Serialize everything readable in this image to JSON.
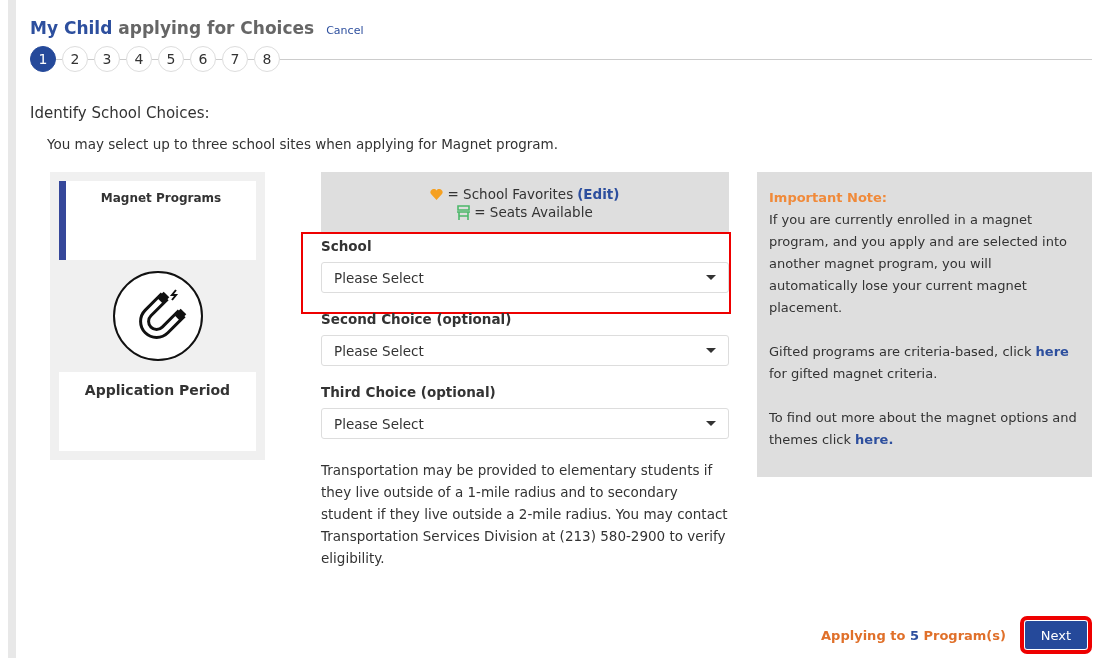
{
  "header": {
    "title_strong": "My Child",
    "title_rest": "applying for Choices",
    "cancel": "Cancel"
  },
  "steps": [
    {
      "label": "1",
      "selected": true
    },
    {
      "label": "2",
      "selected": false
    },
    {
      "label": "3",
      "selected": false
    },
    {
      "label": "4",
      "selected": false
    },
    {
      "label": "5",
      "selected": false
    },
    {
      "label": "6",
      "selected": false
    },
    {
      "label": "7",
      "selected": false
    },
    {
      "label": "8",
      "selected": false
    }
  ],
  "section_title": "Identify School Choices:",
  "intro": "You may select up to three school sites when applying for Magnet program.",
  "sidebar": {
    "tiles": [
      {
        "label": "Magnet Programs",
        "selected": true
      },
      {
        "label": "Application Period",
        "selected": false
      }
    ]
  },
  "legend": {
    "favorites": "= School Favorites",
    "edit": "(Edit)",
    "seats": "= Seats Available"
  },
  "fields": [
    {
      "label": "School",
      "value": "Please Select",
      "highlighted": true
    },
    {
      "label": "Second Choice (optional)",
      "value": "Please Select",
      "highlighted": false
    },
    {
      "label": "Third Choice (optional)",
      "value": "Please Select",
      "highlighted": false
    }
  ],
  "transport_note": "Transportation may be provided to elementary students if they live outside of a 1-mile radius and to secondary student if they live outside a 2-mile radius. You may contact Transportation Services Division at (213) 580-2900 to verify eligibility.",
  "note": {
    "title": "Important Note:",
    "paragraphs": [
      {
        "text": "If you are currently enrolled in a magnet program, and you apply and are selected into another magnet program, you will automatically lose your current magnet placement."
      },
      {
        "text": "Gifted programs are criteria-based, click ",
        "link": "here",
        "after": " for gifted magnet criteria."
      },
      {
        "text": "To find out more about the magnet options and themes click ",
        "link": "here."
      }
    ]
  },
  "footer": {
    "applying_prefix": "Applying to",
    "applying_count": "5",
    "applying_suffix": "Program(s)",
    "next": "Next",
    "next_highlighted": true
  }
}
